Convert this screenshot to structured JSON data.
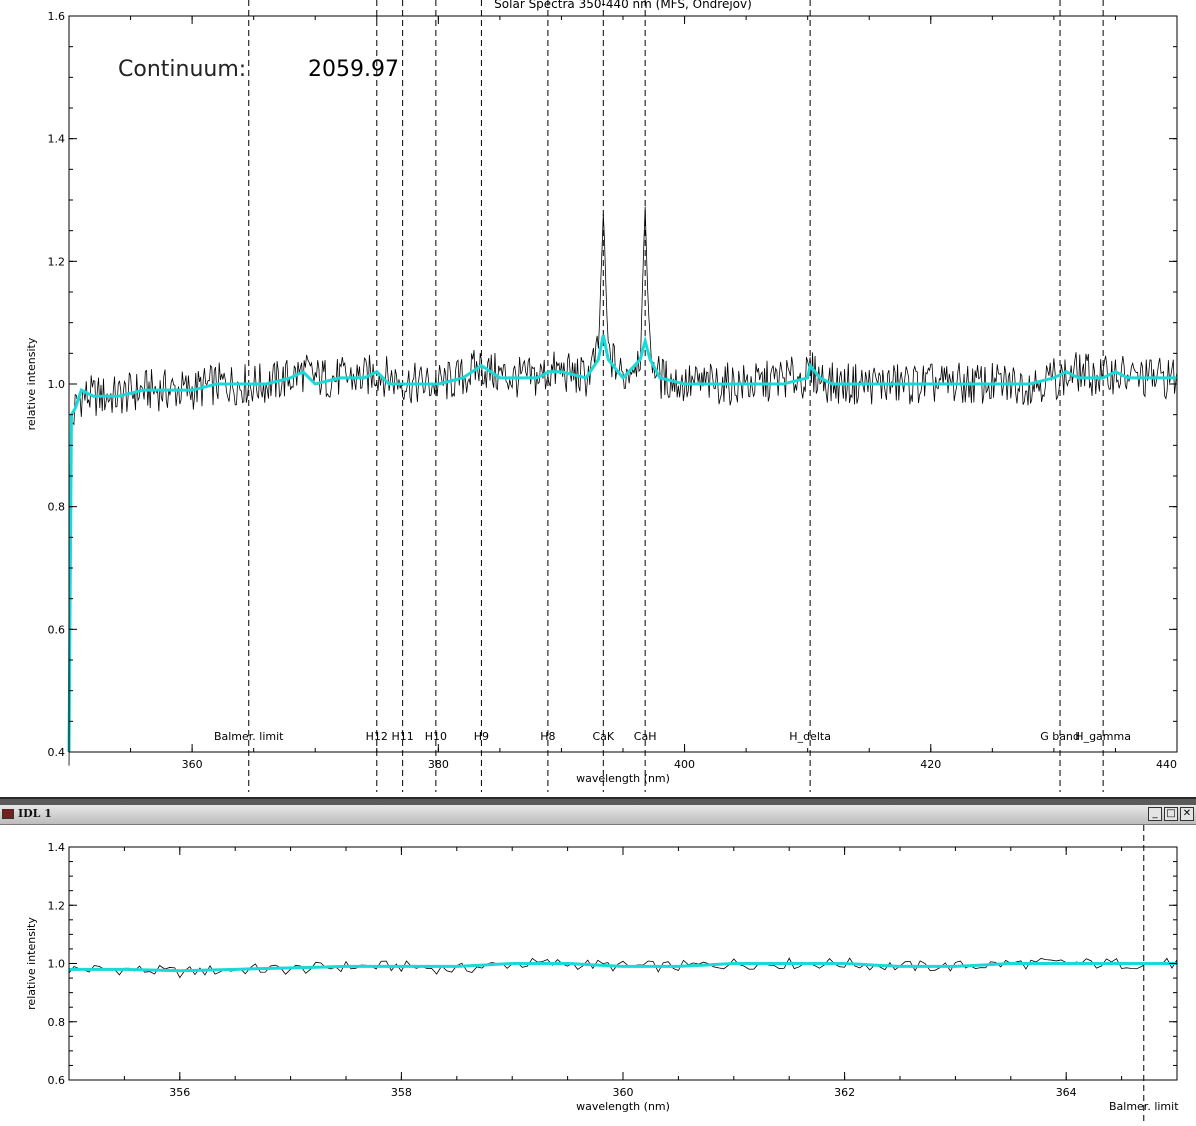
{
  "window": {
    "title": "IDL 1",
    "minimize_label": "_",
    "maximize_label": "□",
    "close_label": "✕"
  },
  "colors": {
    "observed": "#000000",
    "fit": "#19d9d9",
    "axis": "#000000"
  },
  "continuum": {
    "label": "Continuum:",
    "value": "2059.97"
  },
  "chart_data": [
    {
      "type": "line",
      "title": "Solar Spectra 350-440 nm (MFS, Ondrejov)",
      "xlabel": "wavelength (nm)",
      "ylabel": "relative intensity",
      "xlim": [
        350,
        440
      ],
      "ylim": [
        0.4,
        1.6
      ],
      "xticks": [
        360,
        380,
        400,
        420,
        440
      ],
      "yticks": [
        0.4,
        0.6,
        0.8,
        1.0,
        1.2,
        1.4,
        1.6
      ],
      "tick_labels_x": [
        "360",
        "380",
        "400",
        "420",
        "440"
      ],
      "tick_labels_y": [
        "0.4",
        "0.6",
        "0.8",
        "1.0",
        "1.2",
        "1.4",
        "1.6"
      ],
      "lines": [
        {
          "label": "Balmer. limit",
          "x": 364.6
        },
        {
          "label": "H12",
          "x": 375.0
        },
        {
          "label": "H11",
          "x": 377.1
        },
        {
          "label": "H10",
          "x": 379.8
        },
        {
          "label": "H9",
          "x": 383.5
        },
        {
          "label": "H8",
          "x": 388.9
        },
        {
          "label": "CaK",
          "x": 393.4
        },
        {
          "label": "CaH",
          "x": 396.8
        },
        {
          "label": "H_delta",
          "x": 410.2
        },
        {
          "label": "G band",
          "x": 430.5
        },
        {
          "label": "H_gamma",
          "x": 434.0
        }
      ],
      "series": [
        {
          "style": "noisy",
          "x": [
            350.0,
            350.2,
            350.5,
            351,
            352,
            354,
            356,
            358,
            360,
            362,
            364,
            366,
            368,
            369,
            370,
            372,
            374,
            375,
            376,
            378,
            380,
            382,
            383.5,
            384,
            386,
            388,
            389,
            390,
            392,
            393.0,
            393.4,
            393.8,
            395,
            396.4,
            396.8,
            397.2,
            398,
            400,
            402,
            404,
            406,
            408,
            410,
            410.2,
            412,
            414,
            416,
            418,
            420,
            422,
            424,
            426,
            428,
            430,
            431,
            432,
            434,
            435,
            436,
            438,
            440
          ],
          "y": [
            0.4,
            0.93,
            0.96,
            0.98,
            0.98,
            0.98,
            0.99,
            0.99,
            0.99,
            1.0,
            1.0,
            1.0,
            1.01,
            1.02,
            1.01,
            1.01,
            1.01,
            1.02,
            1.01,
            1.0,
            1.0,
            1.01,
            1.03,
            1.02,
            1.01,
            1.01,
            1.02,
            1.02,
            1.01,
            1.05,
            1.28,
            1.05,
            1.01,
            1.05,
            1.28,
            1.05,
            1.01,
            1.0,
            1.0,
            1.0,
            1.0,
            1.01,
            1.01,
            1.02,
            1.0,
            1.0,
            1.0,
            1.0,
            1.0,
            1.0,
            1.0,
            1.0,
            1.0,
            1.01,
            1.01,
            1.02,
            1.01,
            1.02,
            1.01,
            1.01,
            1.01
          ]
        },
        {
          "style": "smooth",
          "x": [
            350.0,
            350.2,
            350.5,
            351,
            352,
            354,
            356,
            358,
            360,
            362,
            364,
            366,
            368,
            369,
            370,
            372,
            374,
            375,
            376,
            378,
            380,
            382,
            383.5,
            385,
            386,
            388,
            389,
            390,
            392,
            393.0,
            393.4,
            393.8,
            395,
            396.4,
            396.8,
            397.2,
            398,
            400,
            402,
            404,
            406,
            408,
            410,
            410.2,
            411,
            412,
            414,
            416,
            418,
            420,
            422,
            424,
            426,
            428,
            430,
            431,
            432,
            434,
            435,
            436,
            438,
            440
          ],
          "y": [
            0.4,
            0.95,
            0.96,
            0.99,
            0.98,
            0.98,
            0.99,
            0.99,
            0.99,
            1.0,
            1.0,
            1.0,
            1.01,
            1.02,
            1.0,
            1.01,
            1.01,
            1.02,
            1.0,
            1.0,
            1.0,
            1.01,
            1.03,
            1.01,
            1.01,
            1.01,
            1.02,
            1.02,
            1.01,
            1.04,
            1.08,
            1.04,
            1.01,
            1.04,
            1.07,
            1.04,
            1.01,
            1.0,
            1.0,
            1.0,
            1.0,
            1.0,
            1.01,
            1.03,
            1.01,
            1.0,
            1.0,
            1.0,
            1.0,
            1.0,
            1.0,
            1.0,
            1.0,
            1.0,
            1.01,
            1.02,
            1.01,
            1.01,
            1.02,
            1.01,
            1.01,
            1.01
          ]
        }
      ]
    },
    {
      "type": "line",
      "xlabel": "wavelength (nm)",
      "ylabel": "relative intensity",
      "xlim": [
        355,
        365
      ],
      "ylim": [
        0.6,
        1.4
      ],
      "xticks": [
        356,
        358,
        360,
        362,
        364
      ],
      "yticks": [
        0.6,
        0.8,
        1.0,
        1.2,
        1.4
      ],
      "tick_labels_x": [
        "356",
        "358",
        "360",
        "362",
        "364"
      ],
      "tick_labels_y": [
        "0.6",
        "0.8",
        "1.0",
        "1.2",
        "1.4"
      ],
      "lines": [
        {
          "label": "Balmer. limit",
          "x": 364.7
        }
      ],
      "series": [
        {
          "style": "noisy",
          "x": [
            355.0,
            355.5,
            356,
            356.5,
            357,
            357.5,
            358,
            358.5,
            359,
            359.5,
            360,
            360.5,
            361,
            361.5,
            362,
            362.5,
            363,
            363.5,
            364,
            364.5,
            365
          ],
          "y": [
            0.98,
            0.98,
            0.97,
            0.98,
            0.98,
            0.99,
            0.99,
            0.98,
            1.0,
            1.0,
            0.99,
            0.99,
            1.0,
            1.0,
            1.0,
            0.99,
            0.99,
            1.0,
            1.0,
            1.0,
            1.0
          ]
        },
        {
          "style": "smooth",
          "x": [
            355.0,
            355.5,
            356,
            356.5,
            357,
            357.5,
            358,
            358.5,
            359,
            359.5,
            360,
            360.5,
            361,
            361.5,
            362,
            362.5,
            363,
            363.5,
            364,
            364.5,
            365
          ],
          "y": [
            0.98,
            0.98,
            0.975,
            0.98,
            0.985,
            0.99,
            0.99,
            0.99,
            1.0,
            1.0,
            0.99,
            0.99,
            1.0,
            1.0,
            1.0,
            0.99,
            0.99,
            1.0,
            1.0,
            1.0,
            1.0
          ]
        }
      ]
    }
  ]
}
